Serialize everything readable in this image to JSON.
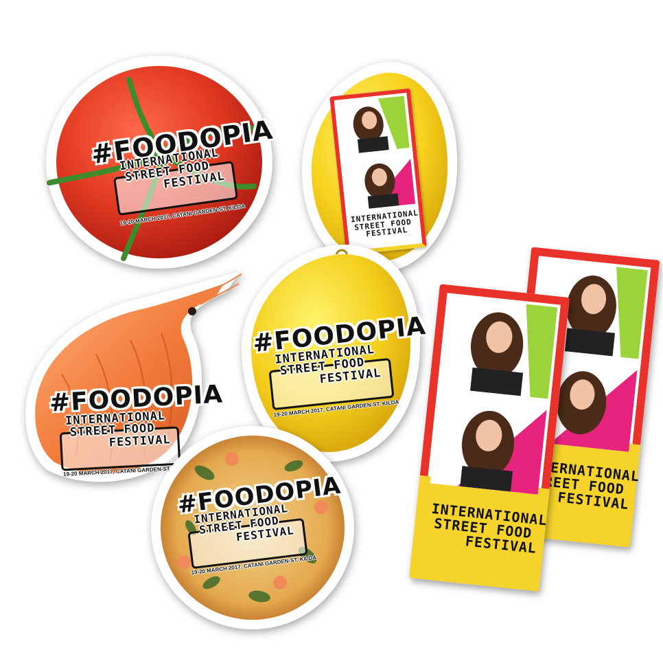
{
  "hashtag": "#FOODOPIA",
  "festival": {
    "line1": "INTERNATIONAL",
    "line2": "STREET FOOD",
    "line3": "FESTIVAL"
  },
  "dates": "19-20 MARCH 2017, CATANI GARDEN-ST. KILDA",
  "colors": {
    "tomato": "#e23a22",
    "lemon": "#f7d21e",
    "prawn": "#f27c3c",
    "pizza": "#e5a94f",
    "strip_red": "#e8322a",
    "strip_yellow": "#f6d32a",
    "strip_green": "#9ad43a",
    "strip_pink": "#e8237d"
  }
}
